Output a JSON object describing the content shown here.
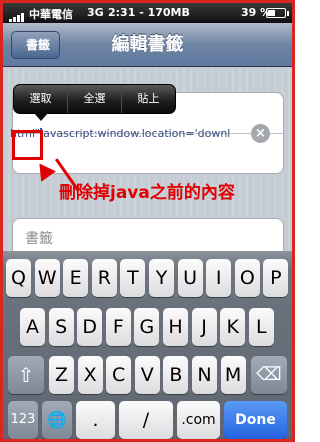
{
  "status": {
    "carrier": "中華電信",
    "network": "3G",
    "time": "2:31 - 170MB",
    "battery": "39 %",
    "battery_level": 0.39
  },
  "nav": {
    "back_label": "書籤",
    "title": "編輯書籤"
  },
  "callout": [
    "選取",
    "全選",
    "貼上"
  ],
  "url_field": {
    "value": "html\"javascript:window.location='downl"
  },
  "annotation": "刪除掉java之前的內容",
  "folder_field": {
    "label": "書籤"
  },
  "keyboard": {
    "row1": [
      "Q",
      "W",
      "E",
      "R",
      "T",
      "Y",
      "U",
      "I",
      "O",
      "P"
    ],
    "row2": [
      "A",
      "S",
      "D",
      "F",
      "G",
      "H",
      "J",
      "K",
      "L"
    ],
    "row3": [
      "Z",
      "X",
      "C",
      "V",
      "B",
      "N",
      "M"
    ],
    "numbers_key": "123",
    "globe_key": "🌐",
    "slash_key": "/",
    "dot_key": ".",
    "dotcom_key": ".com",
    "done_key": "Done",
    "shift_icon": "⇧",
    "delete_icon": "⌫"
  },
  "colors": {
    "annotation_red": "#e10000",
    "done_blue": "#2563e0"
  }
}
